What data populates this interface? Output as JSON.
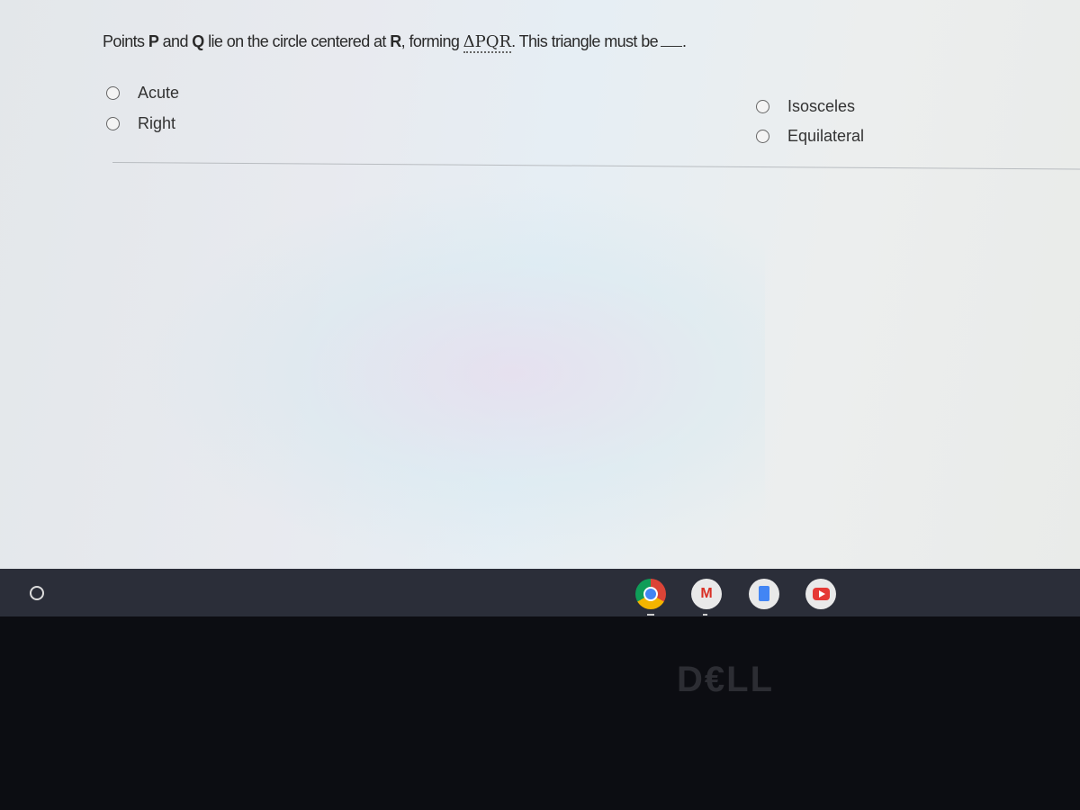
{
  "question": {
    "part1": "Points ",
    "p": "P",
    "part2": " and ",
    "q": "Q",
    "part3": " lie on the circle centered at ",
    "r": "R",
    "part4": ", forming ",
    "triangle": "ΔPQR",
    "part5": ". This triangle must be",
    "end": "."
  },
  "options": [
    {
      "label": "Acute",
      "selected": false
    },
    {
      "label": "Right",
      "selected": false
    },
    {
      "label": "Isosceles",
      "selected": false
    },
    {
      "label": "Equilateral",
      "selected": false
    }
  ],
  "shelf": {
    "apps": [
      {
        "name": "Chrome",
        "icon": "chrome-icon",
        "open": true
      },
      {
        "name": "Gmail",
        "icon": "gmail-icon",
        "open": true
      },
      {
        "name": "Docs",
        "icon": "docs-icon",
        "open": false
      },
      {
        "name": "YouTube",
        "icon": "youtube-icon",
        "open": false
      }
    ]
  },
  "bezel": {
    "logo": "DELL"
  }
}
